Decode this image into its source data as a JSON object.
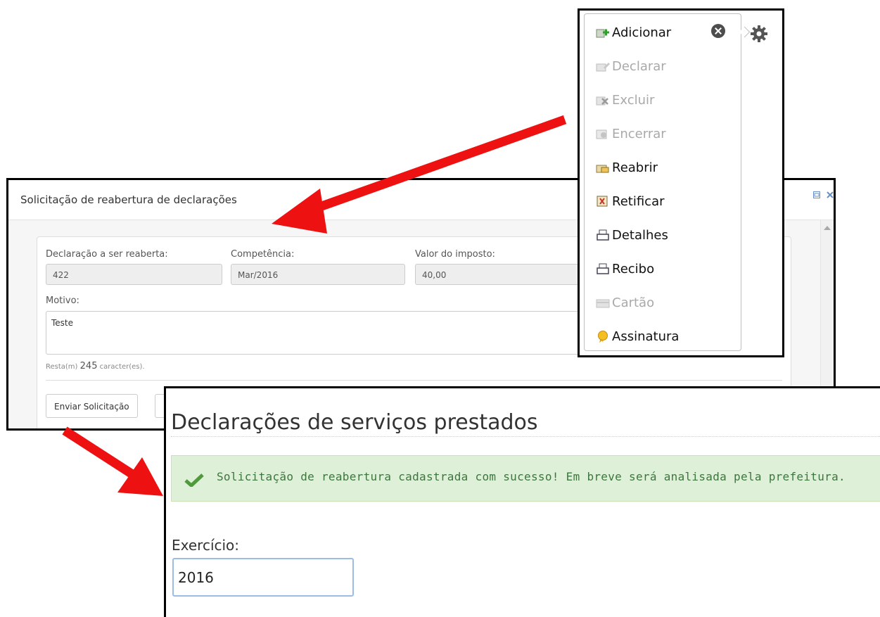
{
  "dialog": {
    "title": "Solicitação de reabertura de declarações",
    "fields": {
      "declaracao_label": "Declaração a ser reaberta:",
      "declaracao_value": "422",
      "competencia_label": "Competência:",
      "competencia_value": "Mar/2016",
      "valor_label": "Valor do imposto:",
      "valor_value": "40,00",
      "motivo_label": "Motivo:",
      "motivo_value": "Teste"
    },
    "counter": {
      "prefix": "Resta(m)",
      "count": "245",
      "suffix": "caracter(es)."
    },
    "send_button": "Enviar Solicitação"
  },
  "menu": {
    "items": [
      {
        "label": "Adicionar",
        "icon": "add-icon",
        "enabled": true
      },
      {
        "label": "Declarar",
        "icon": "declare-icon",
        "enabled": false
      },
      {
        "label": "Excluir",
        "icon": "delete-icon",
        "enabled": false
      },
      {
        "label": "Encerrar",
        "icon": "close-period-icon",
        "enabled": false
      },
      {
        "label": "Reabrir",
        "icon": "reopen-icon",
        "enabled": true
      },
      {
        "label": "Retificar",
        "icon": "rectify-icon",
        "enabled": true
      },
      {
        "label": "Detalhes",
        "icon": "printer-icon",
        "enabled": true
      },
      {
        "label": "Recibo",
        "icon": "printer-icon",
        "enabled": true
      },
      {
        "label": "Cartão",
        "icon": "card-icon",
        "enabled": false
      },
      {
        "label": "Assinatura",
        "icon": "medal-icon",
        "enabled": true
      }
    ]
  },
  "result": {
    "title": "Declarações de serviços prestados",
    "alert": "Solicitação de reabertura cadastrada com sucesso! Em breve será analisada pela prefeitura.",
    "exercicio_label": "Exercício:",
    "exercicio_value": "2016"
  },
  "colors": {
    "alert_bg": "#dff0d8",
    "alert_text": "#3c763d",
    "arrow": "#ee1111",
    "disabled_text": "#a9a9a9"
  }
}
